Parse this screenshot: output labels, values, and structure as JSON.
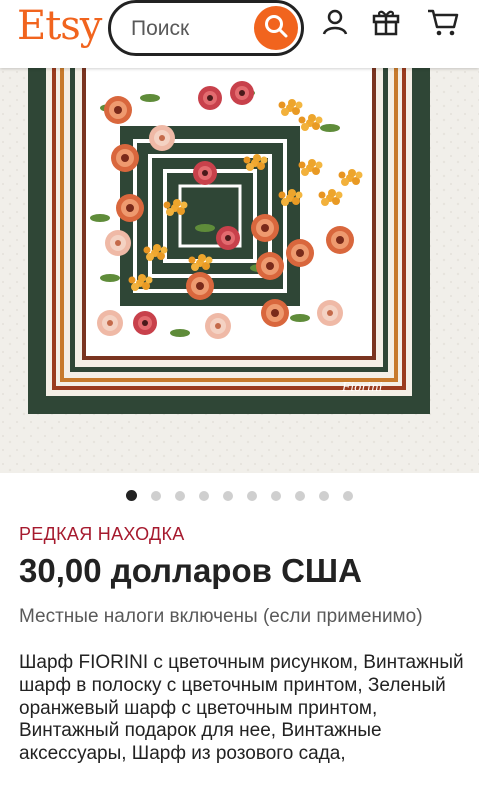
{
  "header": {
    "logo": "Etsy",
    "search_placeholder": "Поиск"
  },
  "icons": {
    "search": "search-icon",
    "account": "user-icon",
    "gift": "gift-icon",
    "cart": "cart-icon"
  },
  "colors": {
    "brand": "#F1641E",
    "rare_label": "#A61A2E",
    "scarf_green": "#2F4636"
  },
  "gallery": {
    "image_alt": "",
    "signature": "Fiorini",
    "total_images": 10,
    "active_index": 0
  },
  "product": {
    "badge": "РЕДКАЯ НАХОДКА",
    "price": "30,00 долларов США",
    "tax_note": "Местные налоги включены (если применимо)",
    "title": "Шарф FIORINI с цветочным рисунком, Винтажный шарф в полоску с цветочным принтом, Зеленый оранжевый шарф с цветочным принтом, Винтажный подарок для нее, Винтажные аксессуары, Шарф из розового сада,"
  }
}
